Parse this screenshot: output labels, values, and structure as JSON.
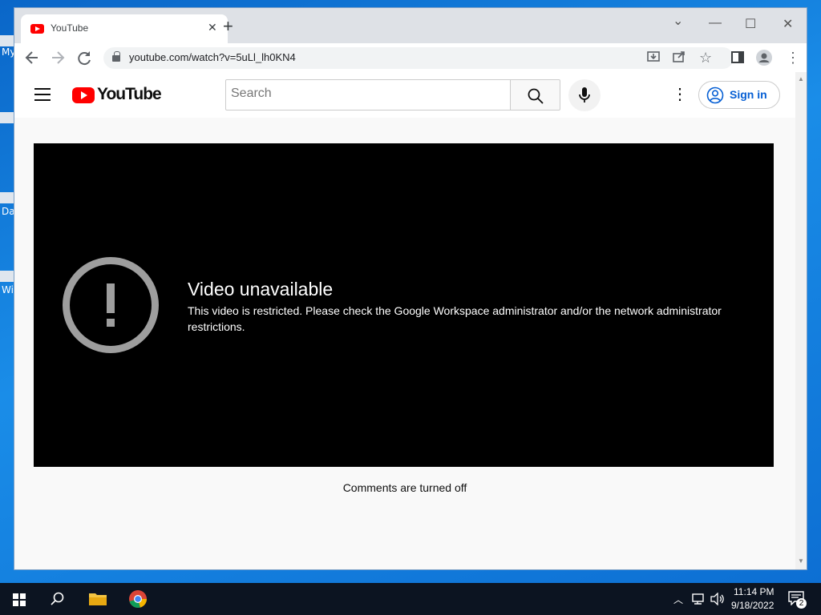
{
  "desktop": {
    "labels": [
      "My",
      "Da",
      "Wi"
    ]
  },
  "browser": {
    "tab_title": "YouTube",
    "new_tab_glyph": "+",
    "tab_close_glyph": "✕",
    "url": "youtube.com/watch?v=5uLl_lh0KN4",
    "window_controls": {
      "chevron": "⌄",
      "minimize": "—",
      "maximize": "☐",
      "close": "✕"
    }
  },
  "youtube": {
    "logo_text": "YouTube",
    "search": {
      "placeholder": "Search"
    },
    "signin_label": "Sign in",
    "kebab_glyph": "⋮",
    "error": {
      "title": "Video unavailable",
      "message": "This video is restricted. Please check the Google Workspace administrator and/or the network administrator restrictions."
    },
    "comments_text": "Comments are turned off"
  },
  "taskbar": {
    "time": "11:14 PM",
    "date": "9/18/2022",
    "notification_count": "2"
  },
  "colors": {
    "youtube_red": "#ff0000",
    "link_blue": "#065fd4",
    "taskbar": "#0c1421"
  }
}
